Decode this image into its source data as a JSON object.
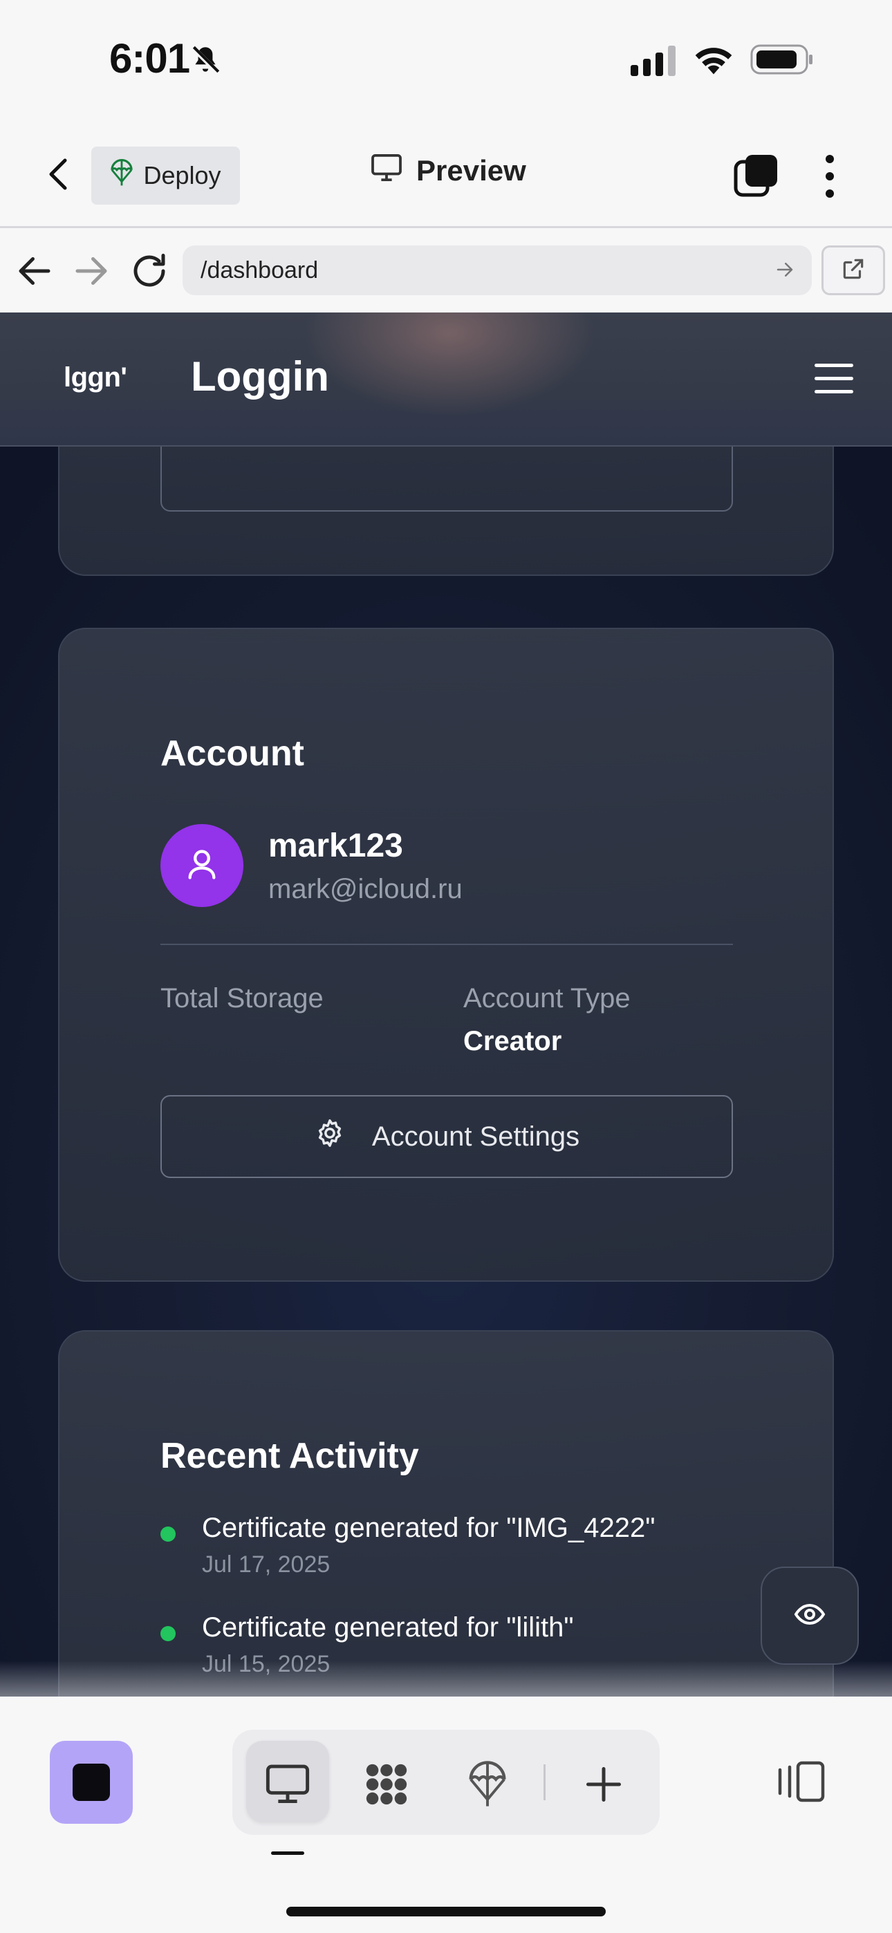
{
  "status_bar": {
    "time": "6:01"
  },
  "header": {
    "deploy_label": "Deploy",
    "title": "Preview"
  },
  "url_bar": {
    "path": "/dashboard"
  },
  "site": {
    "logo_text": "lggn'",
    "brand": "Loggin"
  },
  "account_card": {
    "title": "Account",
    "username": "mark123",
    "email": "mark@icloud.ru",
    "total_storage_label": "Total Storage",
    "account_type_label": "Account Type",
    "account_type_value": "Creator",
    "settings_button": "Account Settings"
  },
  "activity_card": {
    "title": "Recent Activity",
    "items": [
      {
        "text": "Certificate generated for \"IMG_4222\"",
        "date": "Jul 17, 2025"
      },
      {
        "text": "Certificate generated for \"lilith\"",
        "date": "Jul 15, 2025"
      }
    ]
  },
  "colors": {
    "avatar": "#9333ea",
    "activity_dot": "#22c55e",
    "accent_square": "#b4a4f7"
  }
}
